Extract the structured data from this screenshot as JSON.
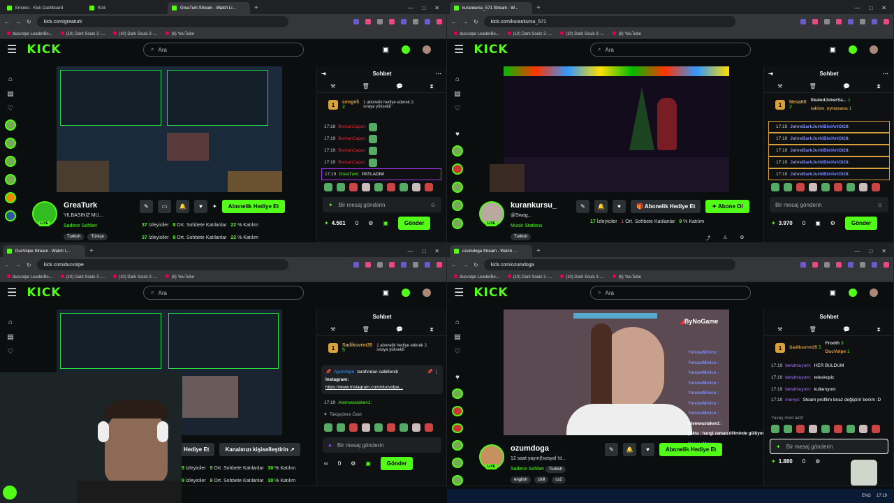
{
  "windows": [
    {
      "tabs": [
        "Emotes - Kick Dashboard",
        "Kick",
        "GreaTurk Stream - Watch Li..."
      ],
      "url": "kick.com/greaturk"
    },
    {
      "tabs": [
        "kurankursu_571 Stream - W..."
      ],
      "url": "kick.com/kurankursu_571"
    },
    {
      "tabs": [
        "DucVolpe Stream - Watch L..."
      ],
      "url": "kick.com/ducvolpe"
    },
    {
      "tabs": [
        "ozumdoga Stream - Watch ..."
      ],
      "url": "kick.com/ozumdoga"
    }
  ],
  "bookmarks": [
    "ducvolpe LeaderBo...",
    "(10) Dark Souls 3 -...",
    "(10) Dark Souls 3 -...",
    "(6) YouTube"
  ],
  "kick": {
    "logo": "KICK",
    "search_placeholder": "Ara",
    "chat_title": "Sohbet",
    "chat_placeholder": "Bir mesaj gönderin",
    "send": "Gönder"
  },
  "w1": {
    "gift_user": "cengeli",
    "gift_count": "2",
    "gift_text": "1 abonelik hediye ederek 2. sıraya yükseldi",
    "messages": [
      {
        "time": "17:19",
        "user": "BerkanCapar:"
      },
      {
        "time": "17:19",
        "user": "BerkanCapar:"
      },
      {
        "time": "17:19",
        "user": "BerkanCapar:"
      },
      {
        "time": "17:19",
        "user": "BerkanCapar:"
      }
    ],
    "highlight": {
      "time": "17:19",
      "user": "GreaTurk:",
      "text": "PATLADIM"
    },
    "points": "4.501",
    "zero": "0",
    "name": "GreaTurk",
    "title": "YILBASINIZ MU...",
    "category": "Sadece Sohbet",
    "tags": [
      "Turkish",
      "Türkçe"
    ],
    "gift_btn": "Abonelik Hediye Et",
    "viewers": "37",
    "viewers_label": "İzleyiciler",
    "chatters": "8",
    "chatters_label": "Ort. Sohbete Katılanlar",
    "pct": "22",
    "pct_label": "% Katılım"
  },
  "w2": {
    "gift_user": "Nesa00",
    "gift_count": "2",
    "top_user": "SkaledJokerSa...",
    "top_count": "1",
    "second_user": "rakion_oynasana",
    "second_count": "1",
    "msg_user": "JahreBarkJurhiBixiArtOl28:",
    "msg_time": "17:19",
    "points": "3.970",
    "zero": "0",
    "name": "kurankursu_",
    "title": "@Swag...",
    "category": "Music Stations",
    "tags": [
      "Turkish"
    ],
    "gift_btn": "Abonelik Hediye Et",
    "sub_btn": "Abone Ol",
    "viewers": "17",
    "viewers_label": "İzleyiciler",
    "chatters": "1",
    "chatters_label": "Ort. Sohbete Katılanlar",
    "pct": "9",
    "pct_label": "% Katılım"
  },
  "w3": {
    "gift_user": "Sadiksvrm35",
    "gift_count": "5",
    "gift_text": "1 abonelik hediye ederek 2. sıraya yükseldi",
    "pinned_by": "AjanVolpe",
    "pinned_suffix": "tarafından sabitlendi",
    "pinned_title": "Instagram:",
    "pinned_link": "https://www.instagram.com/ducvolpe...",
    "msg_time": "17:19",
    "msg_user": "Atemwastaken1:",
    "followers_only": "Takipçilere Özel",
    "zero": "0",
    "gift_btn": "Hediye Et",
    "custom_btn": "Kanalınızı kişiselleştirin",
    "viewers": "9",
    "viewers_label": "İzleyiciler",
    "chatters": "9",
    "chatters_label": "Ort. Sohbete Katılanlar",
    "pct": "30",
    "pct_label": "% Katılım"
  },
  "w4": {
    "top1": "Sadiksvrm35",
    "top1_count": "5",
    "top2": "Frooth",
    "top2_count": "3",
    "top3": "DucVolpe",
    "top3_count": "1",
    "badge": "1",
    "messages": [
      {
        "time": "17:19",
        "user": "betulmuyum:",
        "text": "HER BULDUM"
      },
      {
        "time": "17:19",
        "user": "betulmuyum:",
        "text": "teleskopic"
      },
      {
        "time": "17:19",
        "user": "betulmuyum:",
        "text": "kullanıyom"
      },
      {
        "time": "17:19",
        "user": "imeryo:",
        "text": "Steam profilim biraz değiştirir benim :D"
      }
    ],
    "slow": "Yavaş mod aktif",
    "points": "1.880",
    "zero": "0",
    "name": "ozumdoga",
    "title": "12 saat yayın|!sosyal !d...",
    "category": "Sadece Sohbet",
    "cat_tag": "Turkish",
    "tags": [
      "english",
      "chill",
      "cs2"
    ],
    "gift_btn": "Abonelik Hediye Et",
    "overlay": [
      "YunuseMinico :",
      "YunuseMinico :",
      "YunuseMinico :",
      "YunuseMinico :",
      "YunuseMinico :",
      "YunuseMinico :",
      "YunuseMinico :",
      "Atemwastaken1 :",
      "y3kta : hangi zaman diliminde gülüyorsun",
      "YunuseMinico :",
      "YunuseMinico :",
      "YunuseMinico :",
      "YunuseMinico :",
      "YunuseMinico :",
      "Atemwastaken1 :"
    ],
    "bynogame": "ByNoGame",
    "lang": "ENG",
    "clock": "17:19"
  }
}
